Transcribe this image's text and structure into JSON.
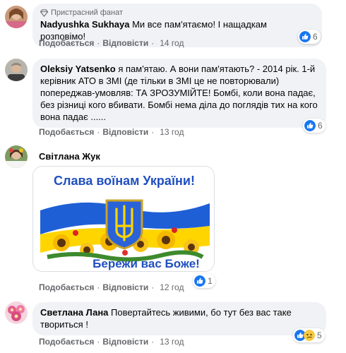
{
  "comments": [
    {
      "badge": "Пристрасний фанат",
      "author": "Nadyushka Sukhaya",
      "text": "Ми все пам'ятаємо! І нащадкам розповімо!",
      "like": "Подобається",
      "reply": "Відповісти",
      "time": "14 год",
      "reaction_count": "6"
    },
    {
      "author": "Oleksiy Yatsenko",
      "text": "я пам'ятаю. А вони пам'ятають? - 2014 рік. 1-й керівник АТО в ЗМІ (де тільки в ЗМІ це не повторювали) попереджав-умовляв: ТА ЗРОЗУМІЙТЕ! Бомбі, коли вона падає, без різниці кого вбивати. Бомбі нема діла до поглядів тих на кого вона падає ......",
      "like": "Подобається",
      "reply": "Відповісти",
      "time": "13 год",
      "reaction_count": "6"
    },
    {
      "author": "Світлана Жук",
      "image_text_top": "Слава воїнам України!",
      "image_text_bottom": "Бережи вас Боже!",
      "like": "Подобається",
      "reply": "Відповісти",
      "time": "12 год",
      "reaction_count": "1"
    },
    {
      "author": "Светлана Лана",
      "text": "Повертайтесь живими, бо тут без вас таке твориться !",
      "like": "Подобається",
      "reply": "Відповісти",
      "time": "13 год",
      "reaction_count": "5"
    }
  ],
  "separator": "·",
  "colors": {
    "bubble": "#f0f2f5",
    "meta_gray": "#65676b",
    "like_blue": "#1877f2",
    "ua_blue": "#1f5fd6",
    "ua_yellow": "#ffd500"
  },
  "icons": [
    "diamond-badge-icon",
    "like-reaction-icon",
    "sad-reaction-icon"
  ]
}
